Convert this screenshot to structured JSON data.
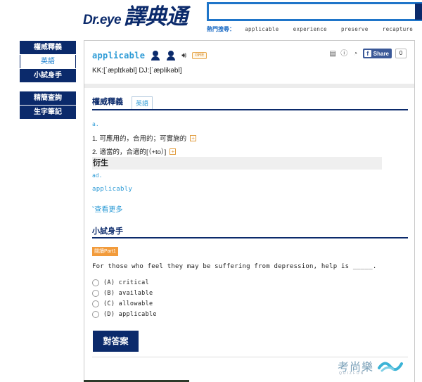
{
  "header": {
    "logo_brand": "Dr.eye",
    "logo_name": "譯典通",
    "search_value": "",
    "hot_label": "熱門搜尋：",
    "hot_terms": [
      "applicable",
      "experience",
      "preserve",
      "recapture"
    ]
  },
  "sidebar": {
    "items": [
      {
        "label": "權威釋義"
      },
      {
        "label": "英語"
      },
      {
        "label": "小試身手"
      },
      {
        "label": "精簡查詢"
      },
      {
        "label": "生字筆記"
      }
    ]
  },
  "entry": {
    "word": "applicable",
    "tag": "GRE",
    "pronunciation": "KK:[ˈæplɪkəbl] DJ:[ˈæplikəbl]",
    "share_label": "Share",
    "share_count": "0"
  },
  "definitions": {
    "section_title": "權威釋義",
    "tab_label": "英語",
    "pos": "a.",
    "senses": [
      "1. 可應用的，合用的；可實施的",
      "2. 適當的，合適的[（+to）]"
    ],
    "derive_title": "衍生",
    "derive_pos": "ad.",
    "derive_word": "applicably",
    "more_label": "查看更多"
  },
  "quiz": {
    "title": "小試身手",
    "badge": "閱讀Part1",
    "question": "For those who feel they may be suffering from depression, help is _____.",
    "options": [
      "(A) critical",
      "(B) available",
      "(C) allowable",
      "(D) applicable"
    ],
    "answer_button": "對答案"
  },
  "watermark": {
    "text": "考尚樂",
    "sub": "QUIZFUN"
  },
  "colors": {
    "navy": "#0b2a6b",
    "link_blue": "#2d9bd6",
    "orange": "#f29b3b",
    "facebook": "#3b5998"
  }
}
